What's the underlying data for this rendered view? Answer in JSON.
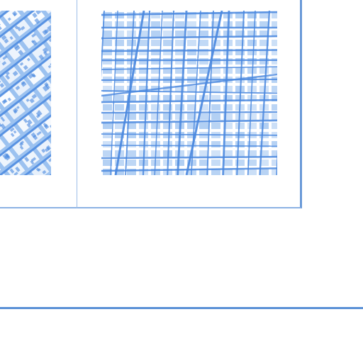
{
  "colors": {
    "tile_base": "#ffffff",
    "tile_ink": "#4a88df",
    "tile_ink_light": "#9cc2f0",
    "frame_border": "#6a9ad8",
    "separator": "#5a91d6"
  },
  "gallery": {
    "thumbnails": [
      {
        "name": "aerial-city-thumbnail",
        "style": "rotated-blocks"
      },
      {
        "name": "street-grid-thumbnail",
        "style": "street-grid"
      }
    ]
  }
}
